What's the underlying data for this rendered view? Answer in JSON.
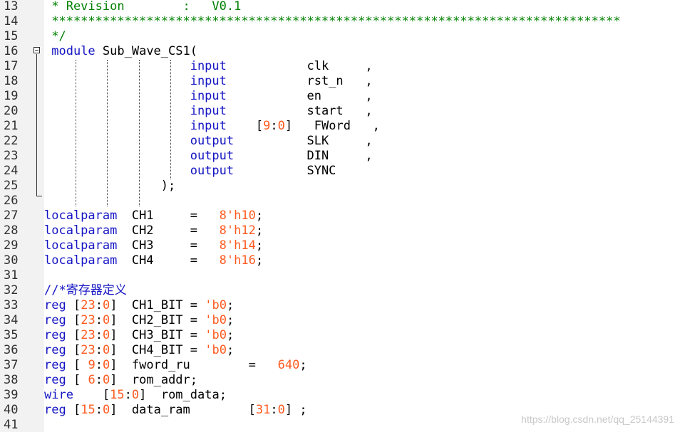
{
  "lines": [
    {
      "no": "13",
      "parts": [
        [
          "c",
          " * Revision        :   V0.1"
        ]
      ]
    },
    {
      "no": "14",
      "parts": [
        [
          "c",
          " ******************************************************************************"
        ]
      ]
    },
    {
      "no": "15",
      "parts": [
        [
          "c",
          " */"
        ]
      ]
    },
    {
      "no": "16",
      "parts": [
        [
          "t",
          " "
        ],
        [
          "k",
          "module"
        ],
        [
          "t",
          " Sub_Wave_CS1("
        ]
      ]
    },
    {
      "no": "17",
      "parts": [
        [
          "t",
          "                    "
        ],
        [
          "k",
          "input"
        ],
        [
          "t",
          "           clk     ,"
        ]
      ]
    },
    {
      "no": "18",
      "parts": [
        [
          "t",
          "                    "
        ],
        [
          "k",
          "input"
        ],
        [
          "t",
          "           rst_n   ,"
        ]
      ]
    },
    {
      "no": "19",
      "parts": [
        [
          "t",
          "                    "
        ],
        [
          "k",
          "input"
        ],
        [
          "t",
          "           en      ,"
        ]
      ]
    },
    {
      "no": "20",
      "parts": [
        [
          "t",
          "                    "
        ],
        [
          "k",
          "input"
        ],
        [
          "t",
          "           start   ,"
        ]
      ]
    },
    {
      "no": "21",
      "parts": [
        [
          "t",
          "                    "
        ],
        [
          "k",
          "input"
        ],
        [
          "t",
          "    ["
        ],
        [
          "n",
          "9"
        ],
        [
          "t",
          ":"
        ],
        [
          "n",
          "0"
        ],
        [
          "t",
          "]   FWord   ,"
        ]
      ]
    },
    {
      "no": "22",
      "parts": [
        [
          "t",
          "                    "
        ],
        [
          "k",
          "output"
        ],
        [
          "t",
          "          SLK     ,"
        ]
      ]
    },
    {
      "no": "23",
      "parts": [
        [
          "t",
          "                    "
        ],
        [
          "k",
          "output"
        ],
        [
          "t",
          "          DIN     ,"
        ]
      ]
    },
    {
      "no": "24",
      "parts": [
        [
          "t",
          "                    "
        ],
        [
          "k",
          "output"
        ],
        [
          "t",
          "          SYNC"
        ]
      ]
    },
    {
      "no": "25",
      "parts": [
        [
          "t",
          "                ); "
        ]
      ]
    },
    {
      "no": "26",
      "parts": []
    },
    {
      "no": "27",
      "parts": [
        [
          "k",
          "localparam"
        ],
        [
          "t",
          "  CH1     =   "
        ],
        [
          "n",
          "8'h10"
        ],
        [
          "t",
          ";"
        ]
      ]
    },
    {
      "no": "28",
      "parts": [
        [
          "k",
          "localparam"
        ],
        [
          "t",
          "  CH2     =   "
        ],
        [
          "n",
          "8'h12"
        ],
        [
          "t",
          ";"
        ]
      ]
    },
    {
      "no": "29",
      "parts": [
        [
          "k",
          "localparam"
        ],
        [
          "t",
          "  CH3     =   "
        ],
        [
          "n",
          "8'h14"
        ],
        [
          "t",
          ";"
        ]
      ]
    },
    {
      "no": "30",
      "parts": [
        [
          "k",
          "localparam"
        ],
        [
          "t",
          "  CH4     =   "
        ],
        [
          "n",
          "8'h16"
        ],
        [
          "t",
          ";"
        ]
      ]
    },
    {
      "no": "31",
      "parts": []
    },
    {
      "no": "32",
      "parts": [
        [
          "z",
          "//*寄存器定义"
        ]
      ]
    },
    {
      "no": "33",
      "parts": [
        [
          "k",
          "reg"
        ],
        [
          "t",
          " ["
        ],
        [
          "n",
          "23"
        ],
        [
          "t",
          ":"
        ],
        [
          "n",
          "0"
        ],
        [
          "t",
          "]  CH1_BIT = "
        ],
        [
          "n",
          "'b0"
        ],
        [
          "t",
          ";"
        ]
      ]
    },
    {
      "no": "34",
      "parts": [
        [
          "k",
          "reg"
        ],
        [
          "t",
          " ["
        ],
        [
          "n",
          "23"
        ],
        [
          "t",
          ":"
        ],
        [
          "n",
          "0"
        ],
        [
          "t",
          "]  CH2_BIT = "
        ],
        [
          "n",
          "'b0"
        ],
        [
          "t",
          ";"
        ]
      ]
    },
    {
      "no": "35",
      "parts": [
        [
          "k",
          "reg"
        ],
        [
          "t",
          " ["
        ],
        [
          "n",
          "23"
        ],
        [
          "t",
          ":"
        ],
        [
          "n",
          "0"
        ],
        [
          "t",
          "]  CH3_BIT = "
        ],
        [
          "n",
          "'b0"
        ],
        [
          "t",
          ";"
        ]
      ]
    },
    {
      "no": "36",
      "parts": [
        [
          "k",
          "reg"
        ],
        [
          "t",
          " ["
        ],
        [
          "n",
          "23"
        ],
        [
          "t",
          ":"
        ],
        [
          "n",
          "0"
        ],
        [
          "t",
          "]  CH4_BIT = "
        ],
        [
          "n",
          "'b0"
        ],
        [
          "t",
          ";"
        ]
      ]
    },
    {
      "no": "37",
      "parts": [
        [
          "k",
          "reg"
        ],
        [
          "t",
          " [ "
        ],
        [
          "n",
          "9"
        ],
        [
          "t",
          ":"
        ],
        [
          "n",
          "0"
        ],
        [
          "t",
          "]  fword_ru        =   "
        ],
        [
          "n",
          "640"
        ],
        [
          "t",
          ";"
        ]
      ]
    },
    {
      "no": "38",
      "parts": [
        [
          "k",
          "reg"
        ],
        [
          "t",
          " [ "
        ],
        [
          "n",
          "6"
        ],
        [
          "t",
          ":"
        ],
        [
          "n",
          "0"
        ],
        [
          "t",
          "]  rom_addr;"
        ]
      ]
    },
    {
      "no": "39",
      "parts": [
        [
          "k",
          "wire"
        ],
        [
          "t",
          "    ["
        ],
        [
          "n",
          "15"
        ],
        [
          "t",
          ":"
        ],
        [
          "n",
          "0"
        ],
        [
          "t",
          "]  rom_data;"
        ]
      ]
    },
    {
      "no": "40",
      "parts": [
        [
          "k",
          "reg"
        ],
        [
          "t",
          " ["
        ],
        [
          "n",
          "15"
        ],
        [
          "t",
          ":"
        ],
        [
          "n",
          "0"
        ],
        [
          "t",
          "]  data_ram        ["
        ],
        [
          "n",
          "31"
        ],
        [
          "t",
          ":"
        ],
        [
          "n",
          "0"
        ],
        [
          "t",
          "] ;"
        ]
      ]
    },
    {
      "no": "41",
      "parts": []
    }
  ],
  "watermark": "https://blog.csdn.net/qq_25144391",
  "colors": {
    "comment": "#008000",
    "keyword": "#1515c4",
    "number": "#ff5a1f",
    "text": "#000000",
    "gutter_bg": "#f2f2f2"
  }
}
